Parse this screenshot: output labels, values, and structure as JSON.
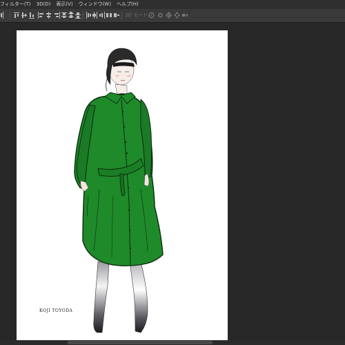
{
  "menu": [
    {
      "name": "menu-filter",
      "label": "フィルター(T)"
    },
    {
      "name": "menu-3d",
      "label": "3D(D)"
    },
    {
      "name": "menu-view",
      "label": "表示(V)"
    },
    {
      "name": "menu-window",
      "label": "ウィンドウ(W)"
    },
    {
      "name": "menu-help",
      "label": "ヘルプ(H)"
    }
  ],
  "options_bar": {
    "mode_label": "3D モード:",
    "tools": [
      "align-icon",
      "align-top-icon",
      "align-vcenter-icon",
      "align-bottom-icon",
      "align-left-icon",
      "align-hcenter-icon",
      "align-right-icon",
      "distribute-top-icon",
      "distribute-vcenter-icon",
      "distribute-bottom-icon",
      "distribute-left-icon",
      "distribute-hcenter-icon",
      "distribute-right-icon",
      "rotate-3d-icon",
      "roll-3d-icon",
      "drag-3d-icon",
      "slide-3d-icon",
      "scale-3d-icon"
    ]
  },
  "canvas": {
    "signature": "KOJI TOYODA",
    "coat_color": "#1f8a2a",
    "background": "#ffffff"
  },
  "colors": {
    "workspace": "#282828",
    "menubar": "#2f2f2f",
    "options_bar": "#3a3a3a"
  }
}
